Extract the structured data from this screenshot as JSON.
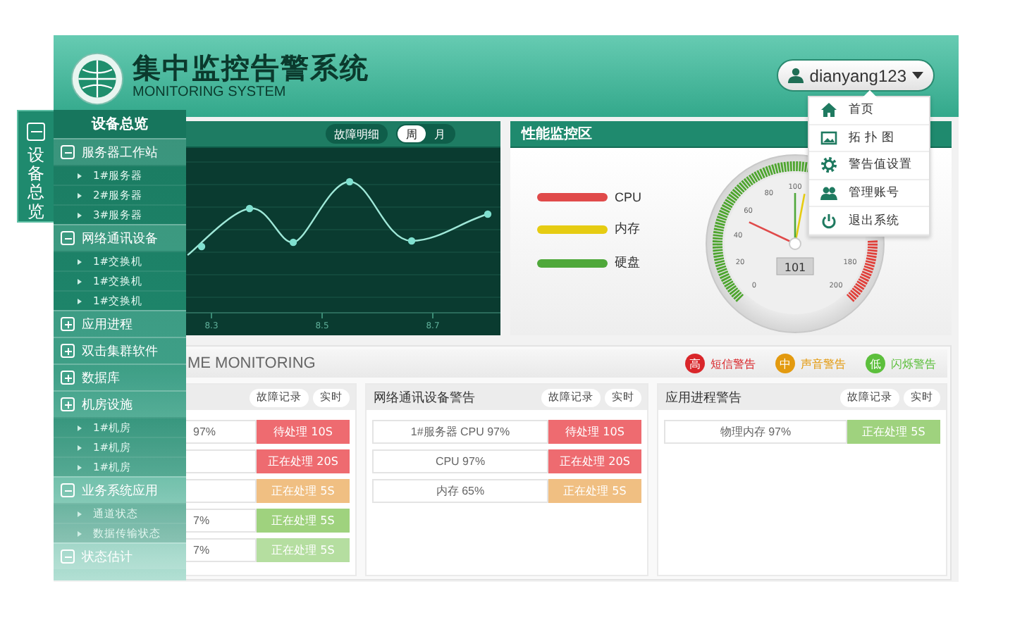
{
  "header": {
    "title": "集中监控告警系统",
    "subtitle": "MONITORING SYSTEM"
  },
  "user_menu": {
    "username": "dianyang123",
    "expanded": true,
    "items": [
      {
        "label": "首页",
        "kind": "home"
      },
      {
        "label": "拓 扑 图",
        "kind": "topology"
      },
      {
        "label": "警告值设置",
        "kind": "settings"
      },
      {
        "label": "管理账号",
        "kind": "account"
      },
      {
        "label": "退出系统",
        "kind": "logout"
      }
    ]
  },
  "sidebar": {
    "tab": {
      "label": "设备总览",
      "expanded": true
    },
    "title": "设备总览",
    "groups": [
      {
        "label": "服务器工作站",
        "expanded": true,
        "children": [
          "1#服务器",
          "2#服务器",
          "3#服务器"
        ]
      },
      {
        "label": "网络通讯设备",
        "expanded": true,
        "children": [
          "1#交换机",
          "1#交换机",
          "1#交换机"
        ]
      },
      {
        "label": "应用进程",
        "expanded": false
      },
      {
        "label": "双击集群软件",
        "expanded": false
      },
      {
        "label": "数据库",
        "expanded": false
      },
      {
        "label": "机房设施",
        "expanded": false,
        "children": [
          "1#机房",
          "1#机房",
          "1#机房"
        ]
      },
      {
        "label": "业务系统应用",
        "expanded": true,
        "children": [
          "通道状态",
          "数据传输状态"
        ]
      },
      {
        "label": "状态估计",
        "expanded": true
      }
    ]
  },
  "chart_panel": {
    "detail_button": "故障明细",
    "period_tabs": [
      {
        "label": "周",
        "selected": true
      },
      {
        "label": "月",
        "selected": false
      }
    ],
    "x_labels": [
      "8.3",
      "8.5",
      "8.7"
    ]
  },
  "performance_panel": {
    "title": "性能监控区",
    "legend": [
      {
        "label": "CPU",
        "color": "#e04a4a"
      },
      {
        "label": "内存",
        "color": "#e6cc12"
      },
      {
        "label": "硬盘",
        "color": "#4fa83a"
      }
    ],
    "scale_labels": [
      "0",
      "20",
      "40",
      "60",
      "80",
      "100",
      "180",
      "200"
    ],
    "reading": "101"
  },
  "monitoring": {
    "title": "ME MONITORING",
    "levels": [
      {
        "badge": "高",
        "label": "短信警告",
        "color": "#d9262a"
      },
      {
        "badge": "中",
        "label": "声音警告",
        "color": "#e39a0f"
      },
      {
        "badge": "低",
        "label": "闪烁警告",
        "color": "#5cbf3c"
      }
    ],
    "cards": [
      {
        "buttons": [
          "故障记录",
          "实时"
        ],
        "rows": [
          {
            "value": "97%",
            "status": "待处理 10S",
            "color": "#ee6b70"
          },
          {
            "status": "正在处理 20S",
            "color": "#ee6b70"
          },
          {
            "status": "正在处理 5S",
            "color": "#f0bf82"
          },
          {
            "value": "7%",
            "status": "正在处理 5S",
            "color": "#9fd27e"
          },
          {
            "value": "7%",
            "status": "正在处理 5S",
            "color": "#b5dea0"
          }
        ]
      },
      {
        "title": "网络通讯设备警告",
        "buttons": [
          "故障记录",
          "实时"
        ],
        "rows": [
          {
            "value": "1#服务器 CPU 97%",
            "status": "待处理 10S",
            "color": "#ee6b70"
          },
          {
            "value": "CPU 97%",
            "status": "正在处理 20S",
            "color": "#ee6b70"
          },
          {
            "value": "内存 65%",
            "status": "正在处理 5S",
            "color": "#f0bf82"
          }
        ]
      },
      {
        "title": "应用进程警告",
        "buttons": [
          "故障记录",
          "实时"
        ],
        "rows": [
          {
            "value": "物理内存 97%",
            "status": "正在处理 5S",
            "color": "#9fd27e"
          }
        ]
      }
    ]
  }
}
